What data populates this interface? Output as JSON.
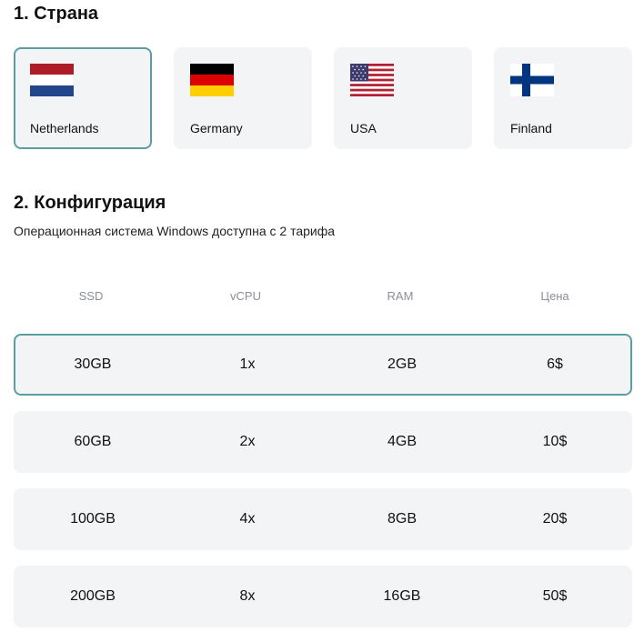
{
  "country_section": {
    "title": "1. Страна",
    "selected": "Netherlands",
    "countries": [
      {
        "name": "Netherlands",
        "flag_icon": "netherlands-flag-icon"
      },
      {
        "name": "Germany",
        "flag_icon": "germany-flag-icon"
      },
      {
        "name": "USA",
        "flag_icon": "usa-flag-icon"
      },
      {
        "name": "Finland",
        "flag_icon": "finland-flag-icon"
      }
    ]
  },
  "config_section": {
    "title": "2. Конфигурация",
    "subtitle": "Операционная система Windows доступна с 2 тарифа",
    "columns": [
      "SSD",
      "vCPU",
      "RAM",
      "Цена"
    ],
    "selected_row": 0,
    "rows": [
      {
        "ssd": "30GB",
        "vcpu": "1x",
        "ram": "2GB",
        "price": "6$"
      },
      {
        "ssd": "60GB",
        "vcpu": "2x",
        "ram": "4GB",
        "price": "10$"
      },
      {
        "ssd": "100GB",
        "vcpu": "4x",
        "ram": "8GB",
        "price": "20$"
      },
      {
        "ssd": "200GB",
        "vcpu": "8x",
        "ram": "16GB",
        "price": "50$"
      }
    ]
  },
  "colors": {
    "accent_border": "#5a9ea3",
    "card_bg": "#f3f4f6",
    "header_text": "#8a8f98"
  }
}
